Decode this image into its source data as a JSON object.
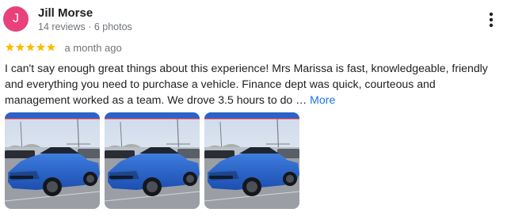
{
  "reviewer": {
    "initial": "J",
    "name": "Jill Morse",
    "meta": "14 reviews · 6 photos",
    "avatar_color": "#e8417b"
  },
  "rating": {
    "stars": 5,
    "max": 5,
    "star_color": "#fbbc04",
    "time_ago": "a month ago"
  },
  "review": {
    "text": "I can't say enough great things about this experience! Mrs Marissa is fast, knowledgeable, friendly and everything you need to purchase a vehicle. Finance dept was quick, courteous and management worked as a team. We drove 3.5 hours to do … ",
    "more_label": "More"
  },
  "photos": [
    {
      "subject": "blue-car-photo"
    },
    {
      "subject": "blue-car-photo"
    },
    {
      "subject": "blue-car-photo"
    }
  ],
  "icons": {
    "menu": "more-vert-icon",
    "star": "star-icon"
  }
}
